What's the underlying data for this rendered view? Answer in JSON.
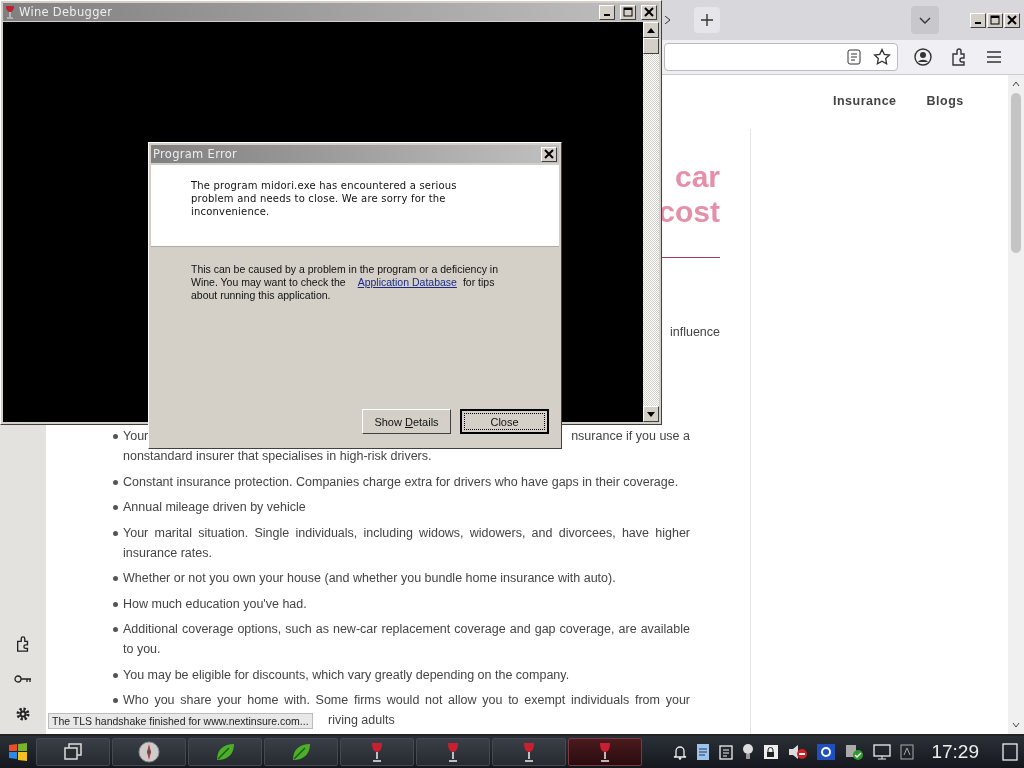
{
  "browser": {
    "nav": [
      {
        "label": "Insurance"
      },
      {
        "label": "Blogs"
      }
    ],
    "article": {
      "heading_lines": [
        "car",
        "cost"
      ],
      "paragraph_fragment": "influence",
      "list": [
        {
          "kind": "split",
          "start": "Your",
          "end": "nsurance if you use a",
          "rest": "nonstandard insurer that specialises in high-risk drivers."
        },
        {
          "kind": "full",
          "text": "Constant insurance protection. Companies charge extra for drivers who have gaps in their coverage."
        },
        {
          "kind": "full",
          "text": "Annual mileage driven by vehicle"
        },
        {
          "kind": "full",
          "text": "Your marital situation. Single individuals, including widows, widowers, and divorcees, have higher insurance rates."
        },
        {
          "kind": "full",
          "text": "Whether or not you own your house (and whether you bundle home insurance with auto)."
        },
        {
          "kind": "full",
          "text": "How much education you've had."
        },
        {
          "kind": "full",
          "text": "Additional coverage options, such as new-car replacement coverage and gap coverage, are available to you."
        },
        {
          "kind": "full",
          "text": "You may be eligible for discounts, which vary greatly depending on the company."
        },
        {
          "kind": "cut",
          "text": "Who you share your home with. Some firms would not allow you to exempt individuals from your",
          "rest": "riving adults"
        }
      ]
    },
    "status_text": "The TLS handshake finished for www.nextinsure.com..."
  },
  "debugger_window": {
    "title": "Wine Debugger"
  },
  "error_dialog": {
    "title": "Program Error",
    "message": "The program midori.exe has encountered a serious problem and needs to close. We are sorry for the inconvenience.",
    "help": {
      "before": "This can be caused by a problem in the program or a deficiency in Wine. You may want to check the",
      "link": "Application Database",
      "after": "for tips about running this application."
    },
    "buttons": [
      {
        "label": "Show ",
        "mnemonic": "D",
        "label_after": "etails",
        "default": false
      },
      {
        "label": "Close",
        "default": true
      }
    ]
  },
  "taskbar": {
    "buttons": [
      {
        "kind": "task-view",
        "selected": false
      },
      {
        "kind": "compass",
        "selected": false
      },
      {
        "kind": "leaf",
        "selected": false
      },
      {
        "kind": "leaf",
        "selected": false
      },
      {
        "kind": "wine",
        "selected": false
      },
      {
        "kind": "wine",
        "selected": false
      },
      {
        "kind": "wine",
        "selected": false
      },
      {
        "kind": "wine",
        "selected": true
      }
    ],
    "clock": "17:29"
  }
}
